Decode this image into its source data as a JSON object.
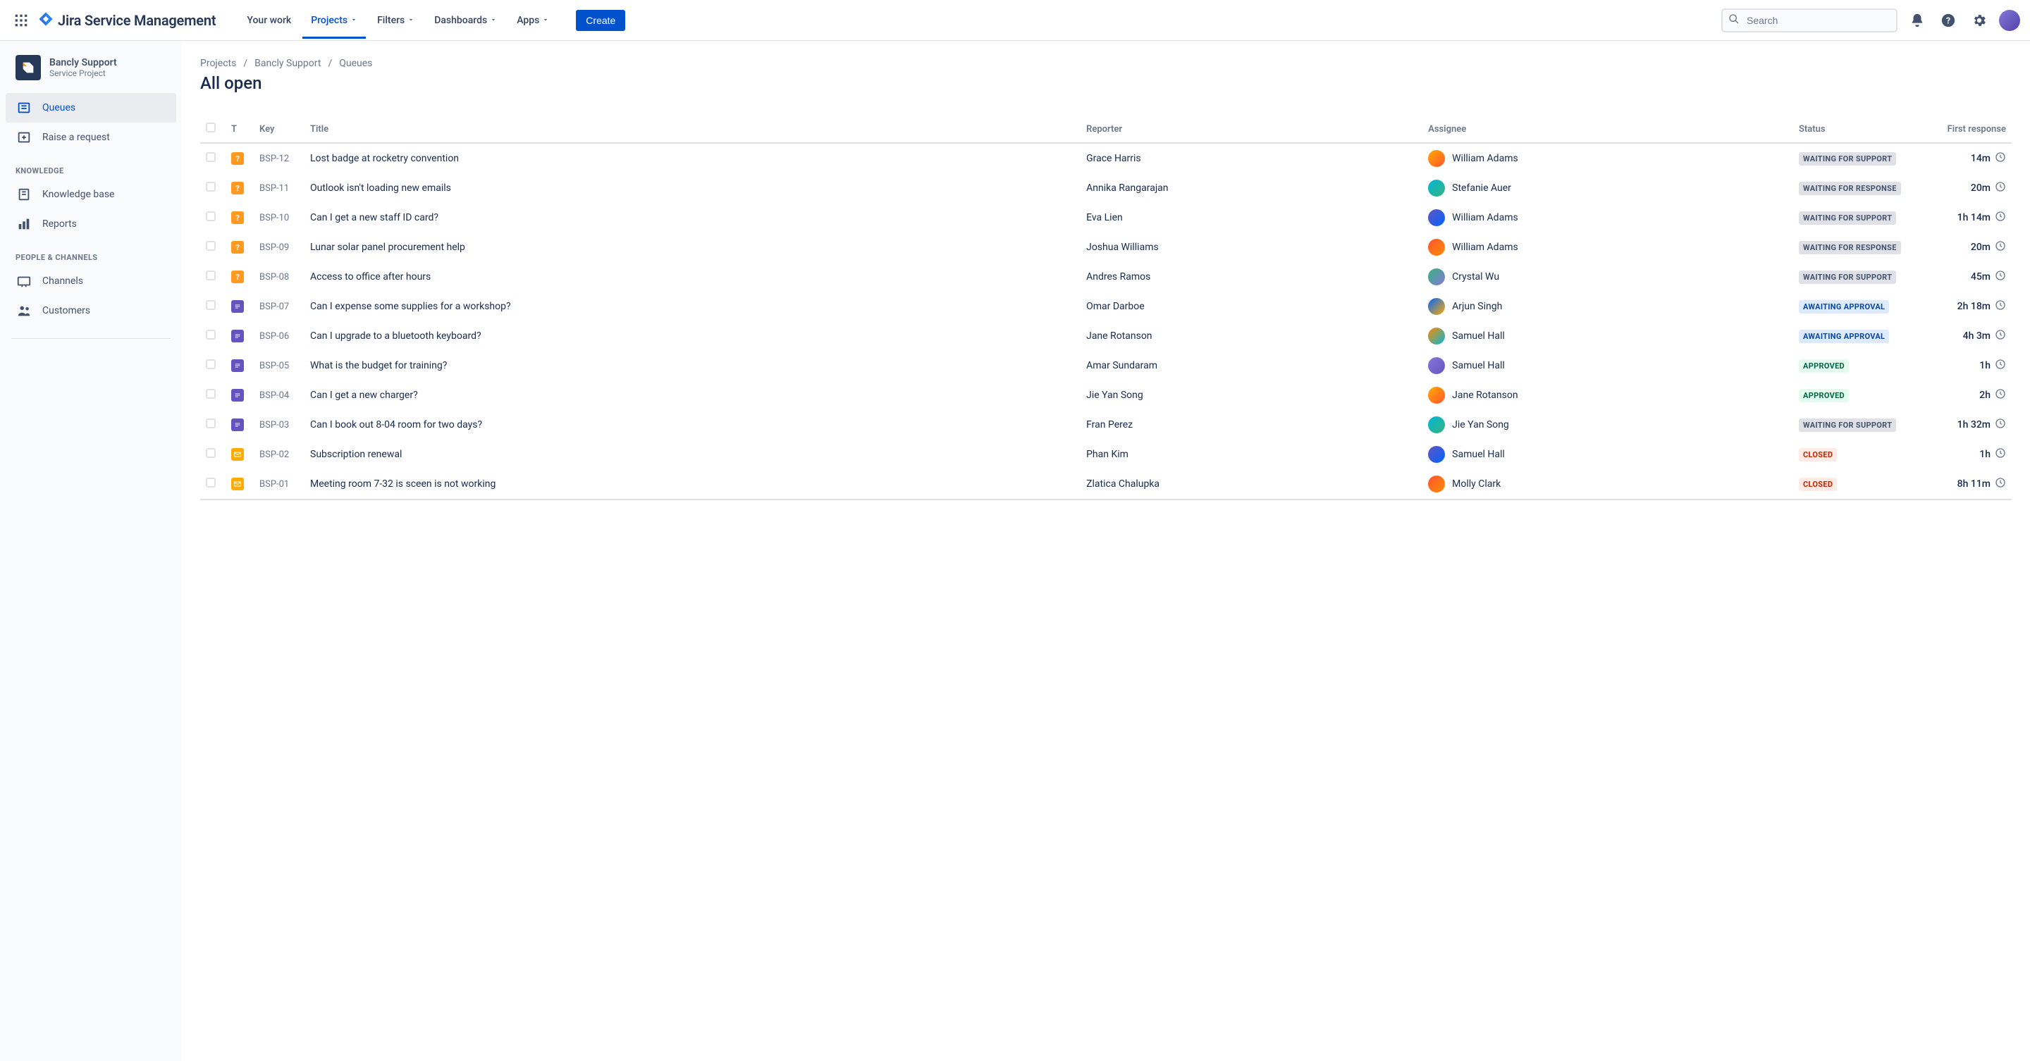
{
  "topnav": {
    "product": "Jira Service Management",
    "items": [
      {
        "label": "Your work",
        "dropdown": false
      },
      {
        "label": "Projects",
        "dropdown": true,
        "active": true
      },
      {
        "label": "Filters",
        "dropdown": true
      },
      {
        "label": "Dashboards",
        "dropdown": true
      },
      {
        "label": "Apps",
        "dropdown": true
      }
    ],
    "create": "Create",
    "search_placeholder": "Search"
  },
  "sidebar": {
    "project_name": "Bancly Support",
    "project_sub": "Service Project",
    "items_top": [
      {
        "label": "Queues",
        "icon": "queues",
        "active": true
      },
      {
        "label": "Raise a request",
        "icon": "raise"
      }
    ],
    "section_knowledge": "KNOWLEDGE",
    "items_knowledge": [
      {
        "label": "Knowledge base",
        "icon": "kb"
      },
      {
        "label": "Reports",
        "icon": "reports"
      }
    ],
    "section_people": "PEOPLE & CHANNELS",
    "items_people": [
      {
        "label": "Channels",
        "icon": "channels"
      },
      {
        "label": "Customers",
        "icon": "customers"
      }
    ]
  },
  "breadcrumbs": [
    "Projects",
    "Bancly Support",
    "Queues"
  ],
  "page_title": "All open",
  "columns": {
    "type": "T",
    "key": "Key",
    "title": "Title",
    "reporter": "Reporter",
    "assignee": "Assignee",
    "status": "Status",
    "first_response": "First response"
  },
  "rows": [
    {
      "type": "help",
      "key": "BSP-12",
      "title": "Lost badge at rocketry convention",
      "reporter": "Grace Harris",
      "assignee": "William Adams",
      "status": "WAITING FOR SUPPORT",
      "status_kind": "grey",
      "first": "14m"
    },
    {
      "type": "help",
      "key": "BSP-11",
      "title": "Outlook isn't loading new emails",
      "reporter": "Annika Rangarajan",
      "assignee": "Stefanie Auer",
      "status": "WAITING FOR RESPONSE",
      "status_kind": "grey",
      "first": "20m"
    },
    {
      "type": "help",
      "key": "BSP-10",
      "title": "Can I get a new staff ID card?",
      "reporter": "Eva Lien",
      "assignee": "William Adams",
      "status": "WAITING FOR SUPPORT",
      "status_kind": "grey",
      "first": "1h 14m"
    },
    {
      "type": "help",
      "key": "BSP-09",
      "title": "Lunar solar panel procurement help",
      "reporter": "Joshua Williams",
      "assignee": "William Adams",
      "status": "WAITING FOR RESPONSE",
      "status_kind": "grey",
      "first": "20m"
    },
    {
      "type": "help",
      "key": "BSP-08",
      "title": "Access to office after hours",
      "reporter": "Andres Ramos",
      "assignee": "Crystal Wu",
      "status": "WAITING FOR SUPPORT",
      "status_kind": "grey",
      "first": "45m"
    },
    {
      "type": "task",
      "key": "BSP-07",
      "title": "Can I expense some supplies for a workshop?",
      "reporter": "Omar Darboe",
      "assignee": "Arjun Singh",
      "status": "AWAITING APPROVAL",
      "status_kind": "blue",
      "first": "2h 18m"
    },
    {
      "type": "task",
      "key": "BSP-06",
      "title": "Can I upgrade to a bluetooth keyboard?",
      "reporter": "Jane Rotanson",
      "assignee": "Samuel Hall",
      "status": "AWAITING APPROVAL",
      "status_kind": "blue",
      "first": "4h 3m"
    },
    {
      "type": "task",
      "key": "BSP-05",
      "title": "What is the budget for training?",
      "reporter": "Amar Sundaram",
      "assignee": "Samuel Hall",
      "status": "APPROVED",
      "status_kind": "green",
      "first": "1h"
    },
    {
      "type": "task",
      "key": "BSP-04",
      "title": "Can I get a new charger?",
      "reporter": "Jie Yan Song",
      "assignee": "Jane Rotanson",
      "status": "APPROVED",
      "status_kind": "green",
      "first": "2h"
    },
    {
      "type": "task",
      "key": "BSP-03",
      "title": "Can I book out 8-04 room for two days?",
      "reporter": "Fran Perez",
      "assignee": "Jie Yan Song",
      "status": "WAITING FOR SUPPORT",
      "status_kind": "grey",
      "first": "1h 32m"
    },
    {
      "type": "mail",
      "key": "BSP-02",
      "title": "Subscription renewal",
      "reporter": "Phan Kim",
      "assignee": "Samuel Hall",
      "status": "CLOSED",
      "status_kind": "red",
      "first": "1h"
    },
    {
      "type": "mail",
      "key": "BSP-01",
      "title": "Meeting room 7-32 is sceen is not working",
      "reporter": "Zlatica Chalupka",
      "assignee": "Molly Clark",
      "status": "CLOSED",
      "status_kind": "red",
      "first": "8h 11m"
    }
  ]
}
